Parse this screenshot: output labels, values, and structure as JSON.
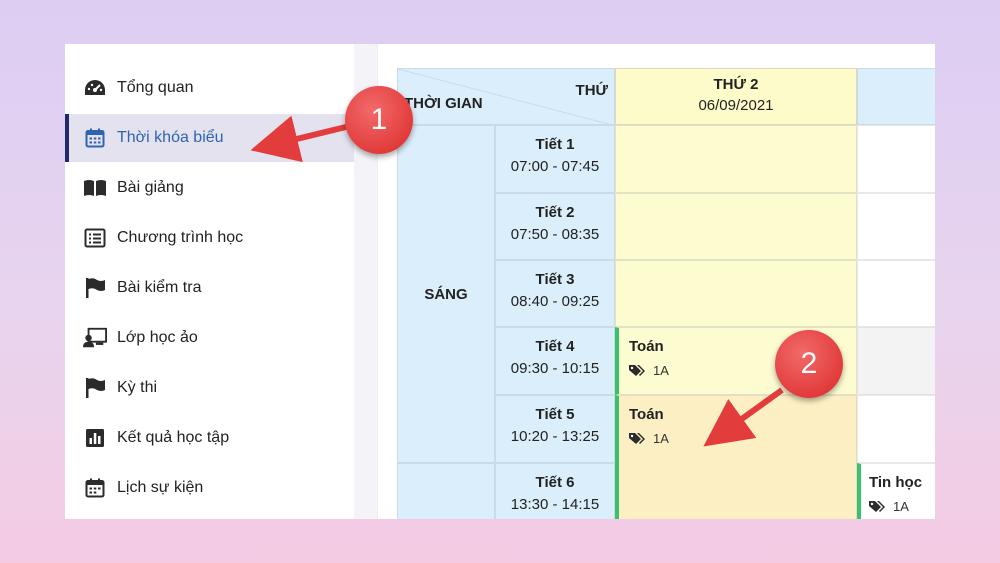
{
  "sidebar": {
    "items": [
      {
        "label": "Tổng quan",
        "icon": "dashboard-icon",
        "active": false
      },
      {
        "label": "Thời khóa biểu",
        "icon": "calendar-icon",
        "active": true
      },
      {
        "label": "Bài giảng",
        "icon": "book-icon",
        "active": false
      },
      {
        "label": "Chương trình học",
        "icon": "list-icon",
        "active": false
      },
      {
        "label": "Bài kiểm tra",
        "icon": "flag-icon",
        "active": false
      },
      {
        "label": "Lớp học ảo",
        "icon": "virtual-class-icon",
        "active": false
      },
      {
        "label": "Kỳ thi",
        "icon": "flag-icon",
        "active": false
      },
      {
        "label": "Kết quả học tập",
        "icon": "bar-chart-icon",
        "active": false
      },
      {
        "label": "Lịch sự kiện",
        "icon": "calendar-icon",
        "active": false
      }
    ]
  },
  "timetable": {
    "corner_time_label": "THỜI GIAN",
    "corner_day_label": "THỨ",
    "day": {
      "name": "THỨ 2",
      "date": "06/09/2021"
    },
    "session_label": "SÁNG",
    "periods": [
      {
        "name": "Tiết 1",
        "time": "07:00 - 07:45"
      },
      {
        "name": "Tiết 2",
        "time": "07:50 - 08:35"
      },
      {
        "name": "Tiết 3",
        "time": "08:40 - 09:25"
      },
      {
        "name": "Tiết 4",
        "time": "09:30 - 10:15"
      },
      {
        "name": "Tiết 5",
        "time": "10:20 - 13:25"
      },
      {
        "name": "Tiết 6",
        "time": "13:30 - 14:15"
      }
    ],
    "lessons": [
      {
        "subject": "Toán",
        "class": "1A"
      },
      {
        "subject": "Toán",
        "class": "1A"
      },
      {
        "subject": "Tin học",
        "class": "1A"
      }
    ]
  },
  "callouts": [
    "1",
    "2"
  ],
  "colors": {
    "accent_blue": "#2f64b0",
    "header_blue": "#dbeefb",
    "day_yellow": "#fdfbc9",
    "lesson_green": "#39c26a",
    "callout_red": "#e23c3c"
  }
}
